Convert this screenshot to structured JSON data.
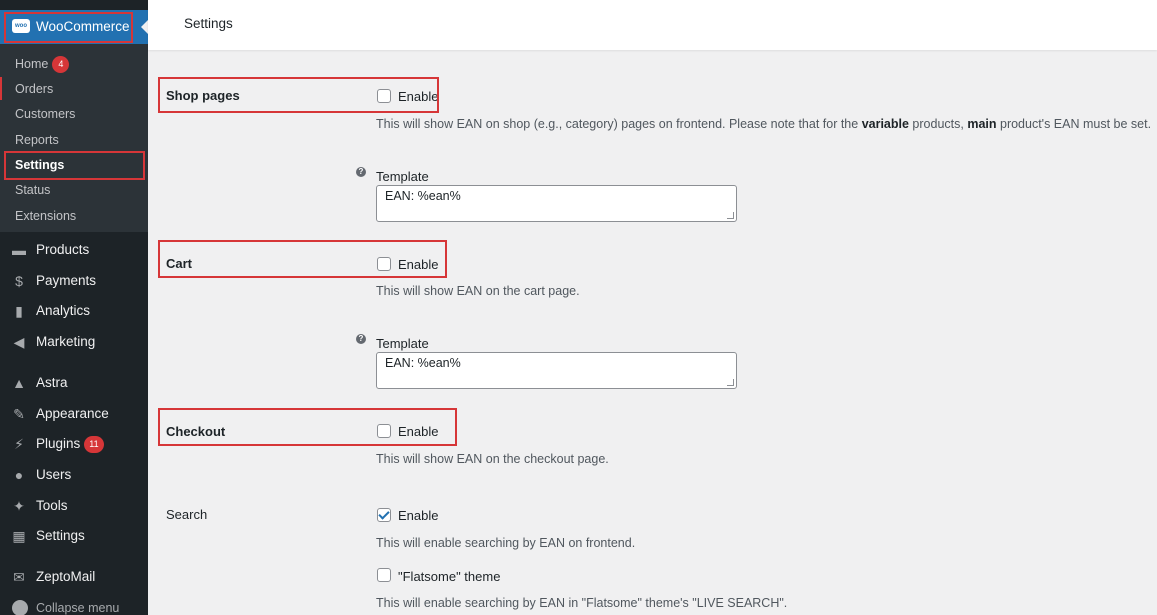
{
  "sidebar": {
    "woocommerce_label": "WooCommerce",
    "woo_logo_text": "woo",
    "submenu": [
      {
        "label": "Home",
        "badge": "4"
      },
      {
        "label": "Orders"
      },
      {
        "label": "Customers"
      },
      {
        "label": "Reports"
      },
      {
        "label": "Settings",
        "active": true
      },
      {
        "label": "Status"
      },
      {
        "label": "Extensions"
      }
    ],
    "menu": [
      {
        "label": "Products",
        "icon": "archive-icon"
      },
      {
        "label": "Payments",
        "icon": "dollar-icon"
      },
      {
        "label": "Analytics",
        "icon": "bar-chart-icon"
      },
      {
        "label": "Marketing",
        "icon": "megaphone-icon"
      },
      {
        "label": "Astra",
        "icon": "astra-icon"
      },
      {
        "label": "Appearance",
        "icon": "paintbrush-icon"
      },
      {
        "label": "Plugins",
        "icon": "plug-icon",
        "badge": "11"
      },
      {
        "label": "Users",
        "icon": "user-icon"
      },
      {
        "label": "Tools",
        "icon": "wrench-icon"
      },
      {
        "label": "Settings",
        "icon": "sliders-icon"
      },
      {
        "label": "ZeptoMail",
        "icon": "mail-icon"
      }
    ],
    "collapse_label": "Collapse menu"
  },
  "topbar": {
    "title": "Settings"
  },
  "settings": {
    "shop_pages": {
      "label": "Shop pages",
      "enable_label": "Enable",
      "checked": false,
      "desc_1": "This will show EAN on shop (e.g., category) pages on frontend. Please note that for the ",
      "desc_b1": "variable",
      "desc_2": " products, ",
      "desc_b2": "main",
      "desc_3": " product's EAN must be set.",
      "template_label": "Template",
      "template_value": "EAN: %ean%"
    },
    "cart": {
      "label": "Cart",
      "enable_label": "Enable",
      "checked": false,
      "desc": "This will show EAN on the cart page.",
      "template_label": "Template",
      "template_value": "EAN: %ean%"
    },
    "checkout": {
      "label": "Checkout",
      "enable_label": "Enable",
      "checked": false,
      "desc": "This will show EAN on the checkout page."
    },
    "search": {
      "label": "Search",
      "enable_label": "Enable",
      "checked": true,
      "desc": "This will enable searching by EAN on frontend.",
      "flatsome_label": "\"Flatsome\" theme",
      "flatsome_checked": false,
      "flatsome_desc": "This will enable searching by EAN in \"Flatsome\" theme's \"LIVE SEARCH\"."
    }
  },
  "help_glyph": "?",
  "colors": {
    "sidebar": "#1d2327",
    "accent": "#2271b1",
    "highlight": "#d63638"
  }
}
